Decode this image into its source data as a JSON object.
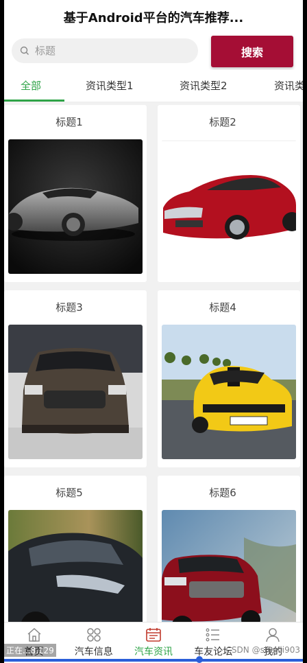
{
  "header": {
    "title": "基于Android平台的汽车推荐..."
  },
  "search": {
    "placeholder": "标题",
    "button_label": "搜索"
  },
  "tabs": [
    {
      "label": "全部",
      "active": true
    },
    {
      "label": "资讯类型1",
      "active": false
    },
    {
      "label": "资讯类型2",
      "active": false
    },
    {
      "label": "资讯类",
      "active": false
    }
  ],
  "cards": [
    {
      "title": "标题1",
      "image": "silver-concept-car"
    },
    {
      "title": "标题2",
      "image": "red-sedan"
    },
    {
      "title": "标题3",
      "image": "brown-buick-sedan"
    },
    {
      "title": "标题4",
      "image": "yellow-camaro"
    },
    {
      "title": "标题5",
      "image": "dark-sports-car"
    },
    {
      "title": "标题6",
      "image": "red-suv"
    }
  ],
  "bottom_nav": [
    {
      "label": "首页",
      "icon": "home-icon",
      "active": false
    },
    {
      "label": "汽车信息",
      "icon": "grid-icon",
      "active": false
    },
    {
      "label": "汽车资讯",
      "icon": "news-icon",
      "active": true
    },
    {
      "label": "车友论坛",
      "icon": "list-icon",
      "active": false
    },
    {
      "label": "我的",
      "icon": "user-icon",
      "active": false
    }
  ],
  "overlay": {
    "status": "正在...8.129",
    "watermark": "CSDN @shenli903"
  },
  "colors": {
    "accent": "#2ea347",
    "button": "#a50e35",
    "progress": "#2b5fd9"
  }
}
